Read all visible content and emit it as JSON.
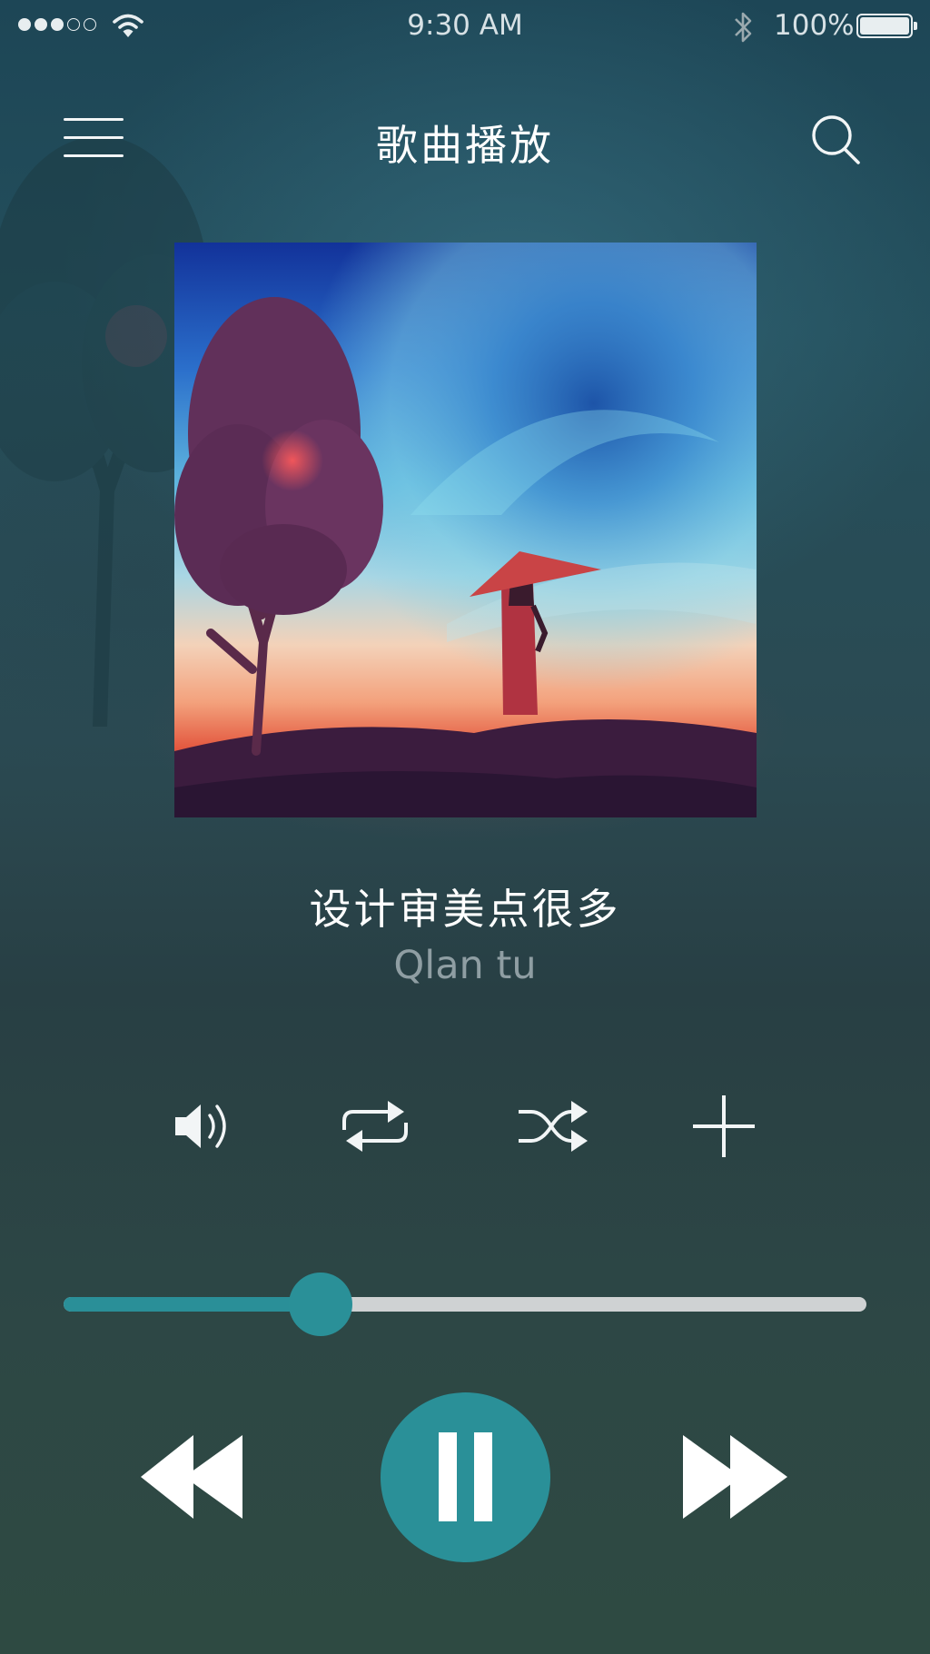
{
  "status_bar": {
    "signal_bars_filled": 3,
    "signal_bars_total": 5,
    "wifi_icon": "wifi-icon",
    "time": "9:30 AM",
    "bluetooth_icon": "bluetooth-icon",
    "battery_percent": "100%",
    "battery_level": 1.0
  },
  "header": {
    "menu_icon": "hamburger-menu-icon",
    "title": "歌曲播放",
    "search_icon": "search-icon"
  },
  "now_playing": {
    "album_art": "album-cover-painting",
    "song_title": "设计审美点很多",
    "artist": "Qlan tu"
  },
  "controls": {
    "volume_icon": "volume-icon",
    "repeat_icon": "repeat-icon",
    "shuffle_icon": "shuffle-icon",
    "add_icon": "plus-icon"
  },
  "progress": {
    "fraction": 0.32
  },
  "playback": {
    "prev_icon": "rewind-icon",
    "pause_icon": "pause-icon",
    "next_icon": "fast-forward-icon"
  },
  "colors": {
    "accent": "#2a9098",
    "track": "#cfd2d3",
    "primary_text": "#ffffff",
    "secondary_text": "#8f9ea3"
  }
}
